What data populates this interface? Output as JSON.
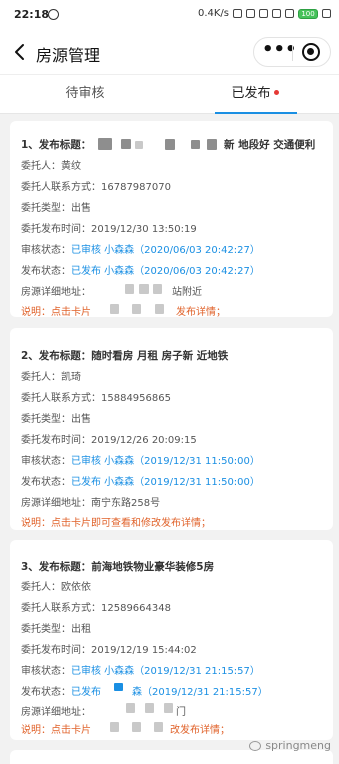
{
  "status_bar": {
    "time": "22:18",
    "speed": "0.4K/s",
    "battery": "100"
  },
  "header": {
    "title": "房源管理",
    "more_glyph": "•••"
  },
  "tabs": [
    {
      "label": "待审核",
      "active": false
    },
    {
      "label": "已发布",
      "active": true,
      "has_dot": true
    }
  ],
  "cards": [
    {
      "title_prefix": "1、发布标题：",
      "title_suffix": "新 地段好 交通便利",
      "client": "委托人：黄纹",
      "phone_label": "委托人联系方式：",
      "phone": "16787987070",
      "type_label": "委托类型：",
      "type": "出售",
      "time_label": "委托发布时间：",
      "time": "2019/12/30 13:50:19",
      "review_label": "审核状态：",
      "review": "已审核 小森森（2020/06/03 20:42:27）",
      "publish_label": "发布状态：",
      "publish": "已发布 小森森（2020/06/03 20:42:27）",
      "address_label": "房源详细地址：",
      "address": "站附近",
      "hint": "说明：点击卡片",
      "hint_tail": "发布详情；"
    },
    {
      "title": "2、发布标题：随时看房 月租 房子新 近地铁",
      "client": "委托人：凯琦",
      "phone_label": "委托人联系方式：",
      "phone": "15884956865",
      "type_label": "委托类型：",
      "type": "出售",
      "time_label": "委托发布时间：",
      "time": "2019/12/26 20:09:15",
      "review_label": "审核状态：",
      "review": "已审核 小森森（2019/12/31 11:50:00）",
      "publish_label": "发布状态：",
      "publish": "已发布 小森森（2019/12/31 11:50:00）",
      "address_label": "房源详细地址：",
      "address": "南宁东路258号",
      "hint": "说明：点击卡片即可查看和修改发布详情；"
    },
    {
      "title": "3、发布标题：前海地铁物业豪华装修5房",
      "client": "委托人：欧依依",
      "phone_label": "委托人联系方式：",
      "phone": "12589664348",
      "type_label": "委托类型：",
      "type": "出租",
      "time_label": "委托发布时间：",
      "time": "2019/12/19 15:44:02",
      "review_label": "审核状态：",
      "review": "已审核 小森森（2019/12/31 21:15:57）",
      "publish_label": "发布状态：",
      "publish_a": "已发布",
      "publish_b": "森（2019/12/31 21:15:57）",
      "address_label": "房源详细地址：",
      "address": "门",
      "hint": "说明：点击卡片",
      "hint_tail": "改发布详情；"
    }
  ],
  "watermark": "springmeng",
  "colors": {
    "accent_blue": "#1a8fe3",
    "hint_orange": "#e0622a",
    "tab_dot_red": "#e53935",
    "background": "#f2f2f2"
  }
}
